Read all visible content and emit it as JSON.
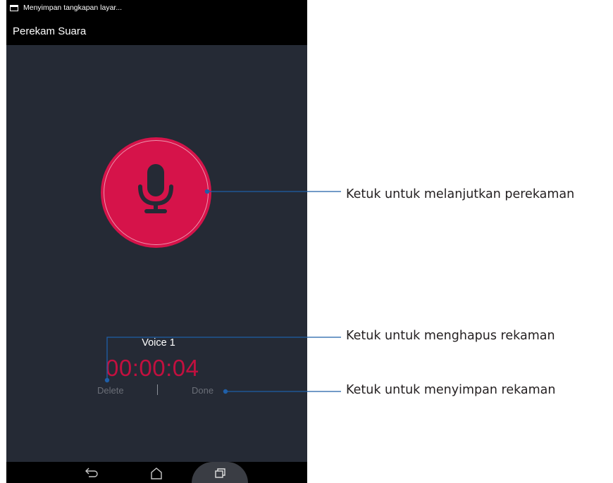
{
  "status_bar": {
    "notification": "Menyimpan tangkapan layar...",
    "icon": "screenshot-icon"
  },
  "app_bar": {
    "title": "Perekam Suara"
  },
  "recorder": {
    "record_icon": "microphone-icon",
    "recording_name": "Voice 1",
    "elapsed_time": "00:00:04",
    "delete_label": "Delete",
    "separator": "|",
    "done_label": "Done"
  },
  "nav_bar": {
    "buttons": [
      "back-icon",
      "home-icon",
      "recent-apps-icon"
    ]
  },
  "callouts": {
    "resume": "Ketuk untuk melanjutkan perekaman",
    "delete": "Ketuk untuk menghapus rekaman",
    "save": "Ketuk untuk menyimpan rekaman"
  },
  "colors": {
    "screen_background": "#252a35",
    "record_button": "#d6134a",
    "timer_text": "#c2103f",
    "callout_line": "#1f5fa8"
  }
}
